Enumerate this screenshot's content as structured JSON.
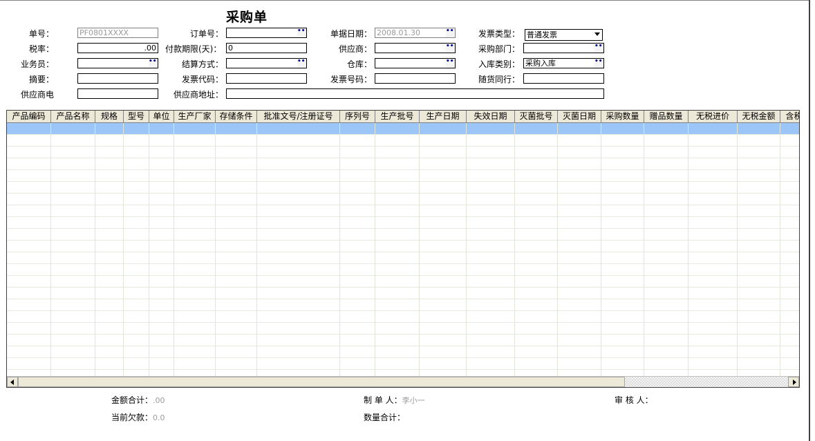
{
  "title": "采购单",
  "fields": {
    "order_no_label": "单号：",
    "order_no_value": "PF0801XXXX",
    "tax_rate_label": "税率：",
    "tax_rate_value": ".00",
    "salesman_label": "业务员：",
    "summary_label": "摘要：",
    "supplier_phone_label": "供应商电",
    "order_number_label": "订单号：",
    "payment_term_label": "付款期限(天)：",
    "payment_term_value": "0",
    "settlement_label": "结算方式：",
    "invoice_code_label": "发票代码：",
    "supplier_address_label": "供应商地址：",
    "doc_date_label": "单据日期：",
    "doc_date_value": "2008.01.30",
    "supplier_label": "供应商：",
    "warehouse_label": "仓库：",
    "invoice_no_label": "发票号码：",
    "invoice_type_label": "发票类型：",
    "invoice_type_value": "普通发票",
    "purchase_dept_label": "采购部门：",
    "stock_in_type_label": "入库类别：",
    "stock_in_type_value": "采购入库",
    "companion_label": "随货同行："
  },
  "grid": {
    "columns": [
      "产品编码",
      "产品名称",
      "规格",
      "型号",
      "单位",
      "生产厂家",
      "存储条件",
      "批准文号/注册证号",
      "序列号",
      "生产批号",
      "生产日期",
      "失效日期",
      "灭菌批号",
      "灭菌日期",
      "采购数量",
      "赠品数量",
      "无税进价",
      "无税金额",
      "含税"
    ]
  },
  "footer": {
    "amount_total_label": "金额合计：",
    "amount_total_value": ".00",
    "current_debt_label": "当前欠款：",
    "current_debt_value": "0.0",
    "maker_label": "制 单 人：",
    "maker_value": "李小一",
    "qty_total_label": "数量合计：",
    "reviewer_label": "审 核 人："
  }
}
